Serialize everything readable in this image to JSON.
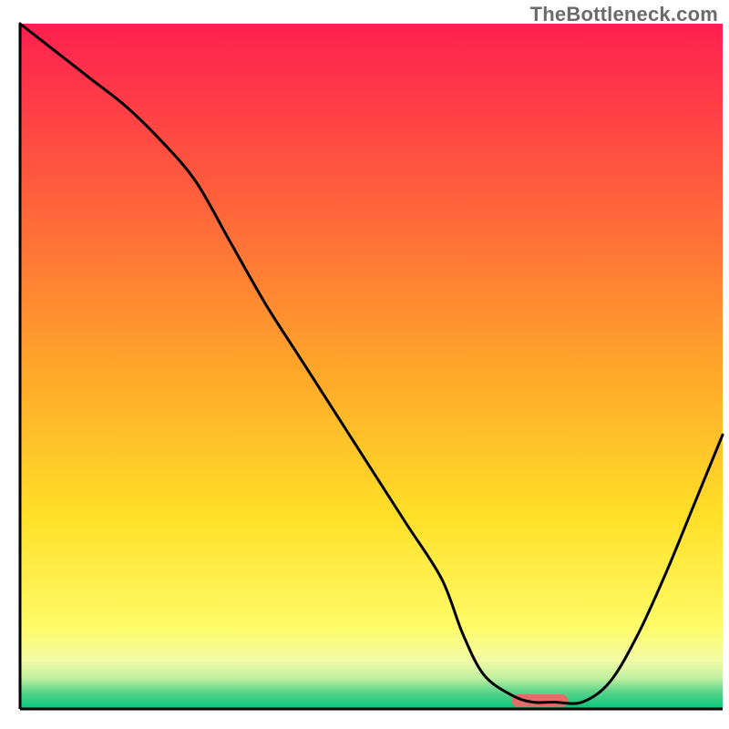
{
  "watermark": "TheBottleneck.com",
  "chart_data": {
    "type": "line",
    "title": "",
    "xlabel": "",
    "ylabel": "",
    "xlim": [
      0,
      100
    ],
    "ylim": [
      0,
      100
    ],
    "x": [
      0,
      5,
      10,
      15,
      20,
      25,
      30,
      35,
      40,
      45,
      50,
      55,
      60,
      63,
      66,
      70,
      73,
      76,
      80,
      84,
      88,
      92,
      96,
      100
    ],
    "values": [
      100,
      96,
      92,
      88,
      83,
      77,
      68,
      59,
      51,
      43,
      35,
      27,
      19,
      11,
      5,
      2,
      1,
      1,
      1,
      4,
      11,
      20,
      30,
      40
    ],
    "marker": {
      "x_start": 70,
      "x_end": 78,
      "color": "#df6d6a"
    },
    "gradient_stops": [
      {
        "offset": 0.0,
        "color": "#ff1f50"
      },
      {
        "offset": 0.25,
        "color": "#ff5f3c"
      },
      {
        "offset": 0.5,
        "color": "#ffa52a"
      },
      {
        "offset": 0.72,
        "color": "#ffe028"
      },
      {
        "offset": 0.88,
        "color": "#fffb68"
      },
      {
        "offset": 0.93,
        "color": "#f2fba6"
      },
      {
        "offset": 0.955,
        "color": "#bff0a0"
      },
      {
        "offset": 0.975,
        "color": "#5cd48a"
      },
      {
        "offset": 1.0,
        "color": "#00c77b"
      }
    ]
  }
}
